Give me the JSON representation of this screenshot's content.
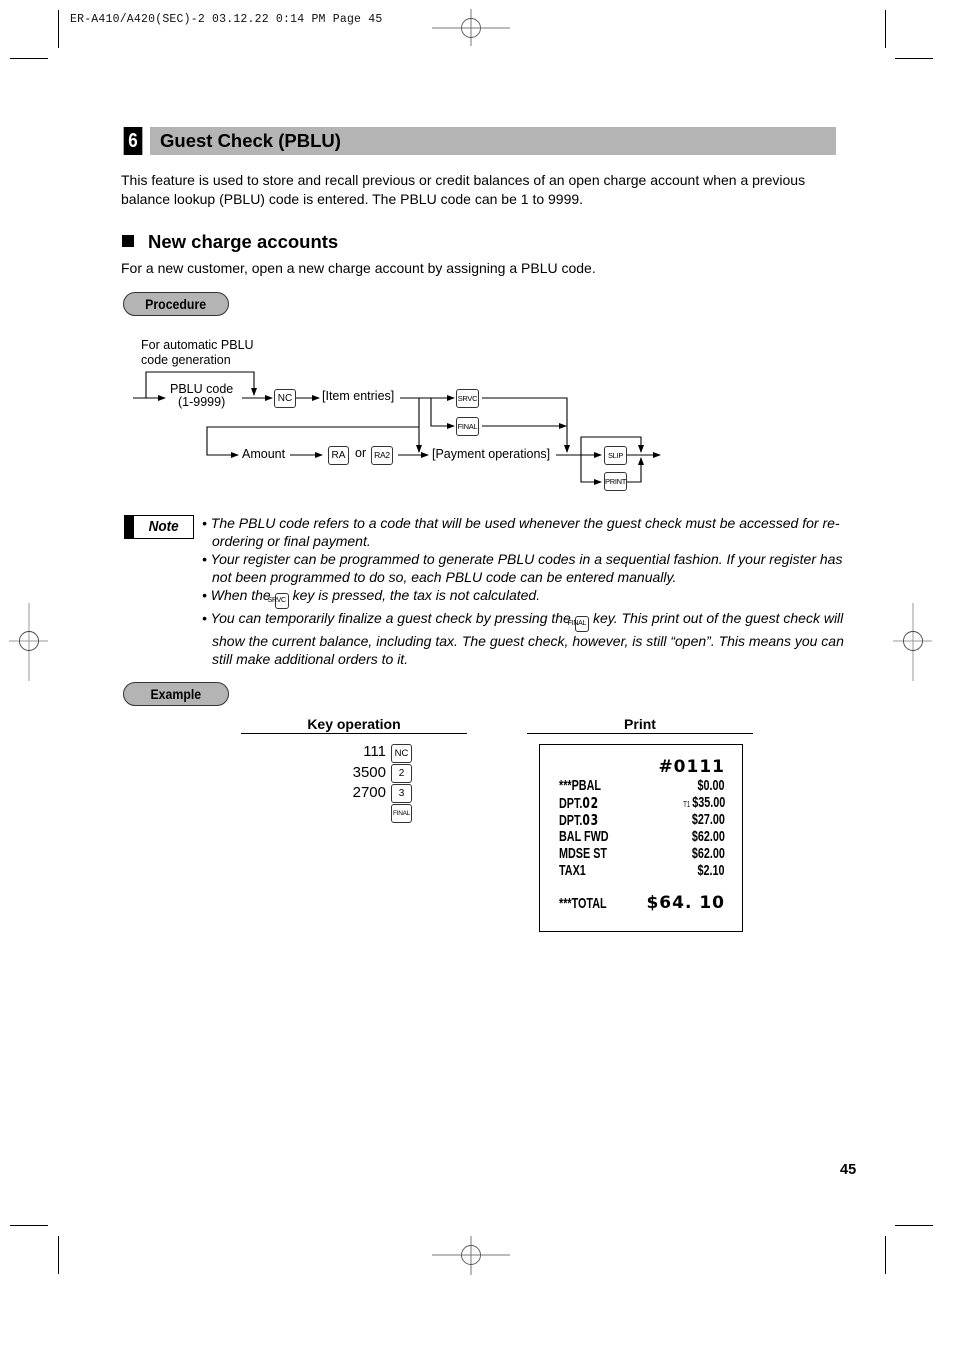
{
  "print_meta": "ER-A410/A420(SEC)-2  03.12.22 0:14 PM  Page 45",
  "section": {
    "number": "6",
    "title": "Guest Check (PBLU)",
    "intro_line1": "This feature is used to store and recall previous or credit balances of an open charge account when a previous",
    "intro_line2": "balance lookup (PBLU) code is entered. The PBLU code can be 1 to 9999."
  },
  "subsection": {
    "title": "New charge accounts",
    "description": "For a new customer, open a new charge account by assigning a PBLU code."
  },
  "procedure": {
    "label": "Procedure",
    "diagram": {
      "auto_note_line1": "For automatic PBLU",
      "auto_note_line2": "code generation",
      "pblu_line1": "PBLU code",
      "pblu_line2": "(1-9999)",
      "item_entries": "[Item entries]",
      "amount": "Amount",
      "or": "or",
      "payment_operations": "[Payment operations]",
      "keys": {
        "nc": "NC",
        "srvc": "SRVC",
        "final": "FINAL",
        "ra": "RA",
        "ra2": "RA2",
        "slip": "SLIP",
        "print": "PRINT"
      }
    }
  },
  "note": {
    "label": "Note",
    "items": [
      {
        "text": "• The PBLU code refers to a code that will be used whenever the guest check must be accessed for re-ordering or final payment."
      },
      {
        "text": "• Your register can be programmed to generate PBLU codes in a sequential fashion. If your register has not been programmed to do so, each PBLU code can be entered manually."
      },
      {
        "before": "• When the ",
        "key": "SRVC",
        "after": " key is pressed, the tax is not calculated."
      },
      {
        "before": "• You can temporarily finalize a guest check by pressing the ",
        "key": "FINAL",
        "after": " key. This print out of the guest check will show the current balance, including tax. The guest check, however, is still “open”. This means you can still make additional orders to it."
      }
    ]
  },
  "example": {
    "label": "Example",
    "key_operation_header": "Key operation",
    "print_header": "Print",
    "key_operations": [
      {
        "value": "111",
        "key": "NC"
      },
      {
        "value": "3500",
        "key": "2"
      },
      {
        "value": "2700",
        "key": "3"
      },
      {
        "value": "",
        "key": "FINAL"
      }
    ],
    "receipt": {
      "check_number": "#0111",
      "lines": [
        {
          "label": "***PBAL",
          "amount": "$0.00",
          "prefix": ""
        },
        {
          "label": "DPT.",
          "label_big": "02",
          "amount": "$35.00",
          "prefix": "T1"
        },
        {
          "label": "DPT.",
          "label_big": "03",
          "amount": "$27.00",
          "prefix": ""
        },
        {
          "label": "BAL FWD",
          "amount": "$62.00",
          "prefix": ""
        },
        {
          "label": "MDSE ST",
          "amount": "$62.00",
          "prefix": ""
        },
        {
          "label": "TAX1",
          "amount": "$2.10",
          "prefix": ""
        }
      ],
      "total_label": "***TOTAL",
      "total_amount": "$64. 10"
    }
  },
  "page_number": "45"
}
